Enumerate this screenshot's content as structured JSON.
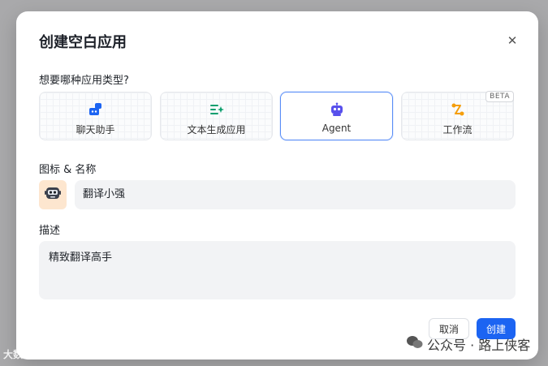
{
  "dialog": {
    "title": "创建空白应用",
    "close_icon": "close-icon"
  },
  "type_section": {
    "label": "想要哪种应用类型?",
    "types": [
      {
        "label": "聊天助手",
        "icon": "chat-bot-icon",
        "icon_color": "#1c64f2"
      },
      {
        "label": "文本生成应用",
        "icon": "text-generator-icon",
        "icon_color": "#0e9f6e"
      },
      {
        "label": "Agent",
        "icon": "robot-icon",
        "icon_color": "#5850ec",
        "selected": true
      },
      {
        "label": "工作流",
        "icon": "workflow-icon",
        "icon_color": "#f59e0b",
        "badge": "BETA"
      }
    ]
  },
  "name_section": {
    "label": "图标 & 名称",
    "avatar_icon": "robot-avatar-icon",
    "name_value": "翻译小强"
  },
  "desc_section": {
    "label": "描述",
    "value": "精致翻译高手"
  },
  "actions": {
    "cancel_label": "取消",
    "create_label": "创建"
  },
  "watermark": {
    "text": "公众号 · 路上侠客",
    "corner_text": "大数据侠"
  },
  "colors": {
    "primary": "#1c64f2",
    "selected_border": "#5a8ef7",
    "input_bg": "#f2f3f5"
  }
}
